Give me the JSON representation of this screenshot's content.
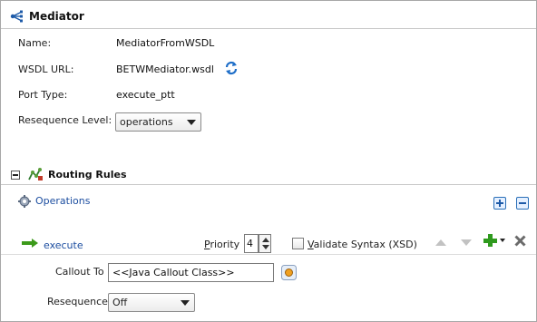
{
  "mediator": {
    "title": "Mediator",
    "name_label": "Name:",
    "name_value": "MediatorFromWSDL",
    "wsdl_label": "WSDL URL:",
    "wsdl_value": "BETWMediator.wsdl",
    "port_label": "Port Type:",
    "port_value": "execute_ptt",
    "reseq_label": "Resequence Level:",
    "reseq_value": "operations"
  },
  "routing": {
    "title": "Routing Rules",
    "operations_label": "Operations"
  },
  "operation": {
    "name": "execute",
    "priority_label_pre": "P",
    "priority_label_rest": "riority",
    "priority_value": "4",
    "validate_label_pre": "V",
    "validate_label_rest": "alidate Syntax (XSD)",
    "callout_label": "Callout To",
    "callout_value": "<<Java Callout Class>>",
    "reseq_label": "Resequence",
    "reseq_value": "Off"
  }
}
